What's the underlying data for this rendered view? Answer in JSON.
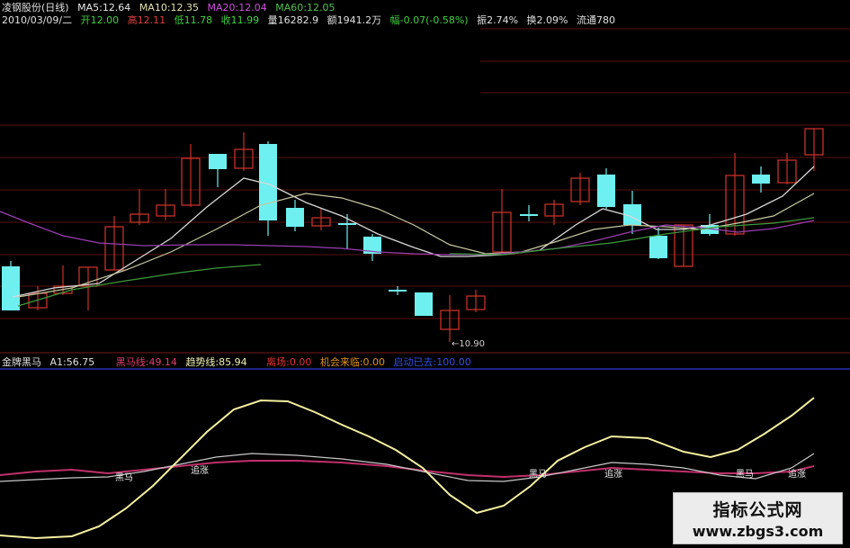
{
  "header": {
    "stock": "凌钢股份(日线)",
    "ma5": "MA5:12.64",
    "ma10": "MA10:12.35",
    "ma20": "MA20:12.04",
    "ma60": "MA60:12.05",
    "date": "2010/03/09/二",
    "open": "开12.00",
    "high": "高12.11",
    "low": "低11.78",
    "close": "收11.99",
    "volume": "量16282.9",
    "amount": "额1941.2万",
    "change": "幅-0.07(-0.58%)",
    "swing": "振2.74%",
    "turnover": "换2.09%",
    "float": "流通780"
  },
  "indicator": {
    "name": "金牌黑马",
    "a1": "A1:56.75",
    "heima": "黑马线:49.14",
    "trend": "趋势线:85.94",
    "quit": "离场:0.00",
    "chance": "机会来临:0.00",
    "start": "启动已去:100.00"
  },
  "labels": {
    "low_price": "←10.90",
    "heima_word": "黑马",
    "zhuizhang_word": "追涨"
  },
  "watermark": {
    "title": "指标公式网",
    "url": "www.zbgs3.com"
  },
  "colors": {
    "up": "#c83228",
    "down": "#6ef0f0",
    "ma5": "#d8d8d8",
    "ma10": "#c8c8a0",
    "ma20": "#9a3db0",
    "ma60": "#3c9a3c",
    "yellow": "#f5f0a0",
    "magenta": "#c0306a",
    "grid": "#5a0f0f"
  }
}
